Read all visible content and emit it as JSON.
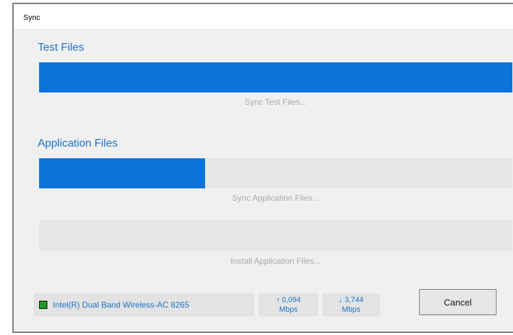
{
  "window": {
    "title": "Sync"
  },
  "test_files": {
    "heading": "Test Files",
    "progress": 1.0,
    "caption": "Sync Test Files..."
  },
  "application_files": {
    "heading": "Application Files",
    "sync_progress": 0.35,
    "sync_caption": "Sync Application Files...",
    "install_progress": 0.0,
    "install_caption": "Install Application Files..."
  },
  "status": {
    "network_icon": "network-adapter-icon",
    "network_name": "Intel(R) Dual Band Wireless-AC 8265",
    "upload_value": "↑ 0,094",
    "upload_unit": "Mbps",
    "download_value": "↓ 3,744",
    "download_unit": "Mbps"
  },
  "buttons": {
    "cancel_label": "Cancel"
  },
  "colors": {
    "accent": "#0a74da",
    "heading": "#1a73c9",
    "status_ok": "#1f9d1f"
  }
}
